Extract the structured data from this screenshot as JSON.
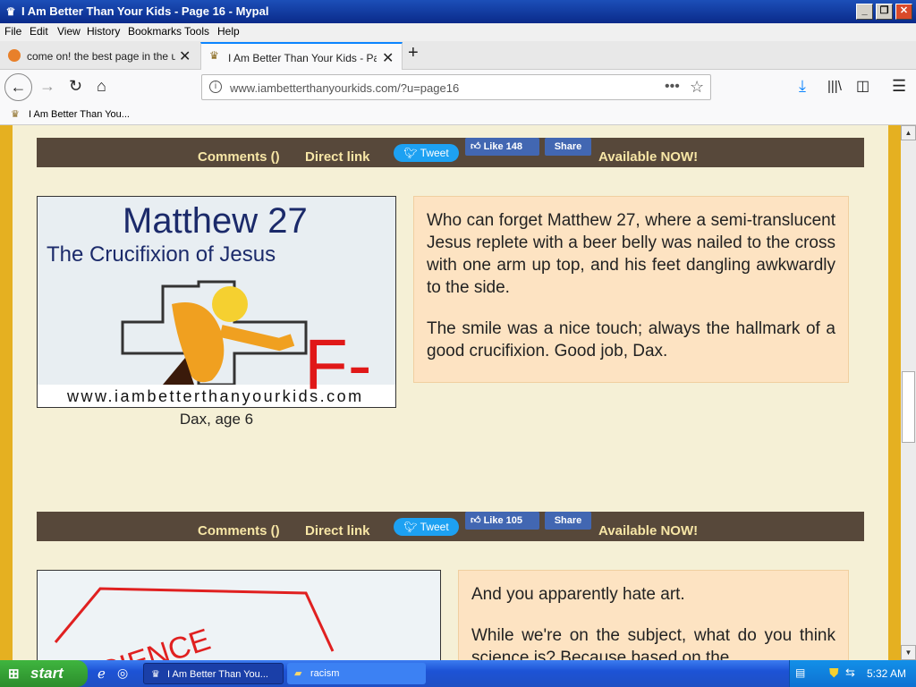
{
  "window": {
    "title": "I Am Better Than Your Kids - Page 16 - Mypal"
  },
  "menu": [
    "File",
    "Edit",
    "View",
    "History",
    "Bookmarks",
    "Tools",
    "Help"
  ],
  "tabs": [
    {
      "label": "come on! the best page in the uni"
    },
    {
      "label": "I Am Better Than Your Kids - Page"
    }
  ],
  "nav": {
    "url": "www.iambetterthanyourkids.com/?u=page16"
  },
  "bookmarks": [
    {
      "label": "I Am Better Than You..."
    }
  ],
  "posts": [
    {
      "bar": {
        "comments": "Comments ()",
        "direct_link": "Direct link",
        "tweet": "Tweet",
        "like": "Like 148",
        "share": "Share",
        "available": "Available NOW!"
      },
      "image": {
        "title_line1": "Matthew 27",
        "title_line2": "The Crucifixion of Jesus",
        "grade": "F-",
        "watermark": "www.iambetterthanyourkids.com"
      },
      "caption": "Dax, age 6",
      "paragraphs": [
        "Who can forget Matthew 27, where a semi-translucent Jesus replete with a beer belly was nailed to the cross with one arm up top, and his feet dangling awkwardly to the side.",
        "The smile was a nice touch; always the hallmark of a good crucifixion. Good job, Dax."
      ]
    },
    {
      "bar": {
        "comments": "Comments ()",
        "direct_link": "Direct link",
        "tweet": "Tweet",
        "like": "Like 105",
        "share": "Share",
        "available": "Available NOW!"
      },
      "image": {
        "word": "SCIENCE"
      },
      "paragraphs": [
        "And you apparently hate art.",
        "While we're on the subject, what do you think science is? Because based on the"
      ]
    }
  ],
  "taskbar": {
    "start": "start",
    "items": [
      {
        "label": "I Am Better Than You..."
      },
      {
        "label": "racism"
      }
    ],
    "clock": "5:32 AM"
  },
  "colors": {
    "accent_stripe": "#e5b021",
    "post_bar": "#57483a",
    "post_bar_text": "#f7e6a6",
    "text_box": "#fde3c2",
    "page_bg": "#f5f0d6"
  }
}
